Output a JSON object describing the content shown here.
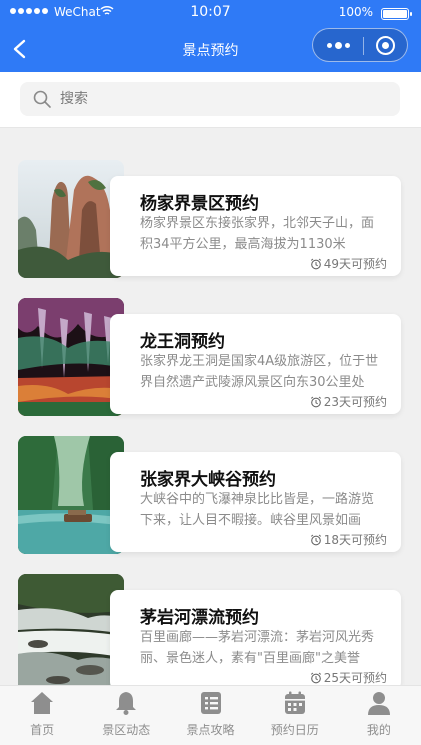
{
  "status_bar": {
    "carrier": "WeChat",
    "time": "10:07",
    "battery": "100%"
  },
  "nav": {
    "title": "景点预约"
  },
  "search": {
    "placeholder": "搜索"
  },
  "cards": [
    {
      "title": "杨家界景区预约",
      "desc": "杨家界景区东接张家界，北邻天子山，面积34平方公里，最高海拔为1130米",
      "days": "49天可预约"
    },
    {
      "title": "龙王洞预约",
      "desc": "张家界龙王洞是国家4A级旅游区，位于世界自然遗产武陵源风景区向东30公里处",
      "days": "23天可预约"
    },
    {
      "title": "张家界大峡谷预约",
      "desc": "大峡谷中的飞瀑神泉比比皆是，一路游览下来，让人目不暇接。峡谷里风景如画",
      "days": "18天可预约"
    },
    {
      "title": "茅岩河漂流预约",
      "desc": "百里画廊——茅岩河漂流：茅岩河风光秀丽、景色迷人，素有\"百里画廊\"之美誉",
      "days": "25天可预约"
    }
  ],
  "tabs": [
    {
      "label": "首页",
      "icon": "home-icon"
    },
    {
      "label": "景区动态",
      "icon": "bell-icon"
    },
    {
      "label": "景点攻略",
      "icon": "list-icon"
    },
    {
      "label": "预约日历",
      "icon": "calendar-icon"
    },
    {
      "label": "我的",
      "icon": "user-icon"
    }
  ],
  "colors": {
    "accent": "#2f7af6",
    "tab_icon": "#8e8e8e"
  }
}
